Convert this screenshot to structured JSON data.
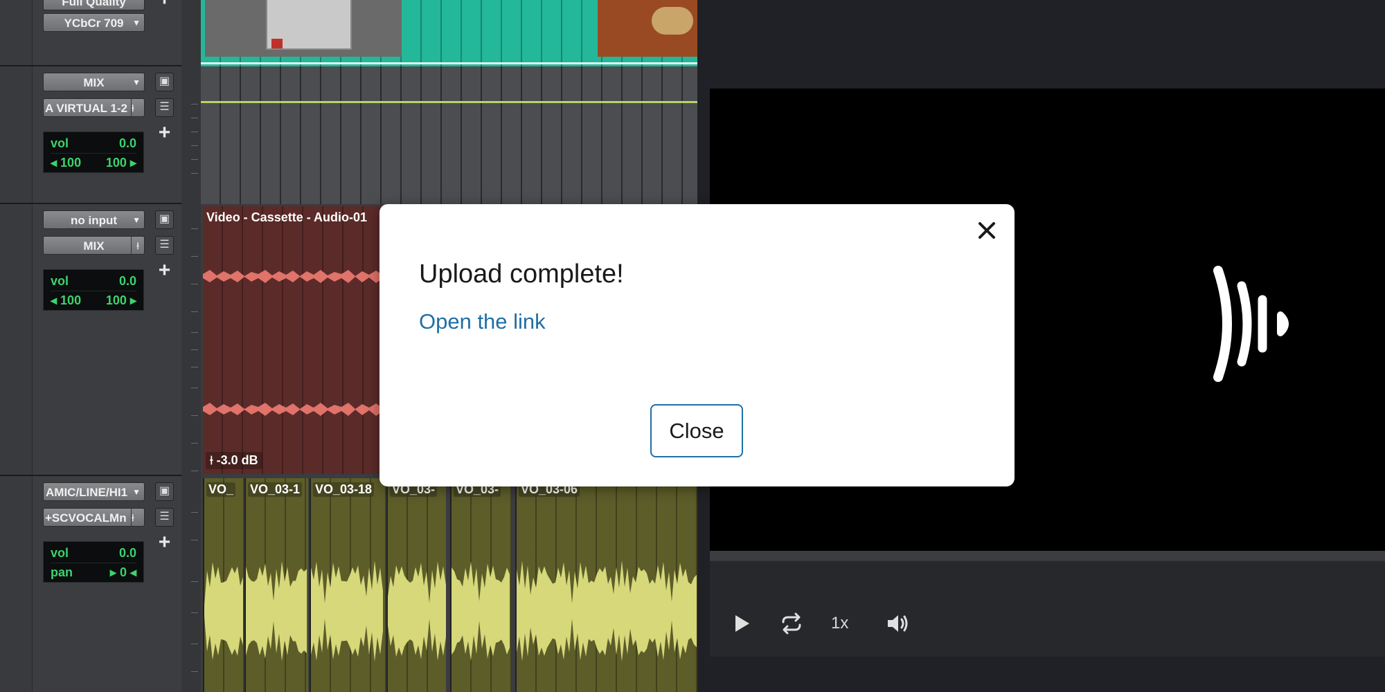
{
  "tracks": [
    {
      "name": "video-track",
      "controls": {
        "top_btn_label": "Full Quality",
        "color_btn_label": "YCbCr 709"
      }
    },
    {
      "name": "mix-track",
      "controls": {
        "input_label": "MIX",
        "output_label": "A VIRTUAL 1-2",
        "vol_label": "vol",
        "vol_value": "0.0",
        "pan_left": "100",
        "pan_right": "100"
      }
    },
    {
      "name": "cassette-track",
      "controls": {
        "input_label": "no input",
        "output_label": "MIX",
        "vol_label": "vol",
        "vol_value": "0.0",
        "pan_left": "100",
        "pan_right": "100"
      },
      "clip_label": "Video - Cassette - Audio-01",
      "gain_label": "-3.0 dB"
    },
    {
      "name": "vo-track",
      "controls": {
        "input_label": "AMIC/LINE/HI1",
        "output_label": "+SCVOCALMn",
        "vol_label": "vol",
        "vol_value": "0.0",
        "pan_label": "pan",
        "pan_value": "0"
      },
      "clips": [
        "VO_",
        "VO_03-1",
        "VO_03-18",
        "VO_03-",
        "VO_03-",
        "VO_03-06"
      ]
    }
  ],
  "player": {
    "speed_label": "1x",
    "icons": [
      "play-icon",
      "loop-icon",
      "volume-icon",
      "audio-wave-icon"
    ]
  },
  "dialog": {
    "title": "Upload complete!",
    "link_text": "Open the link",
    "close_label": "Close"
  },
  "colors": {
    "video_clip": "#23b89a",
    "cassette_clip": "#5b2b29",
    "cassette_wave": "#e0736a",
    "vo_clip": "#5d5d2a",
    "vo_wave": "#d6d87a",
    "meter_text": "#3bd36e",
    "link": "#1f6fa6"
  }
}
